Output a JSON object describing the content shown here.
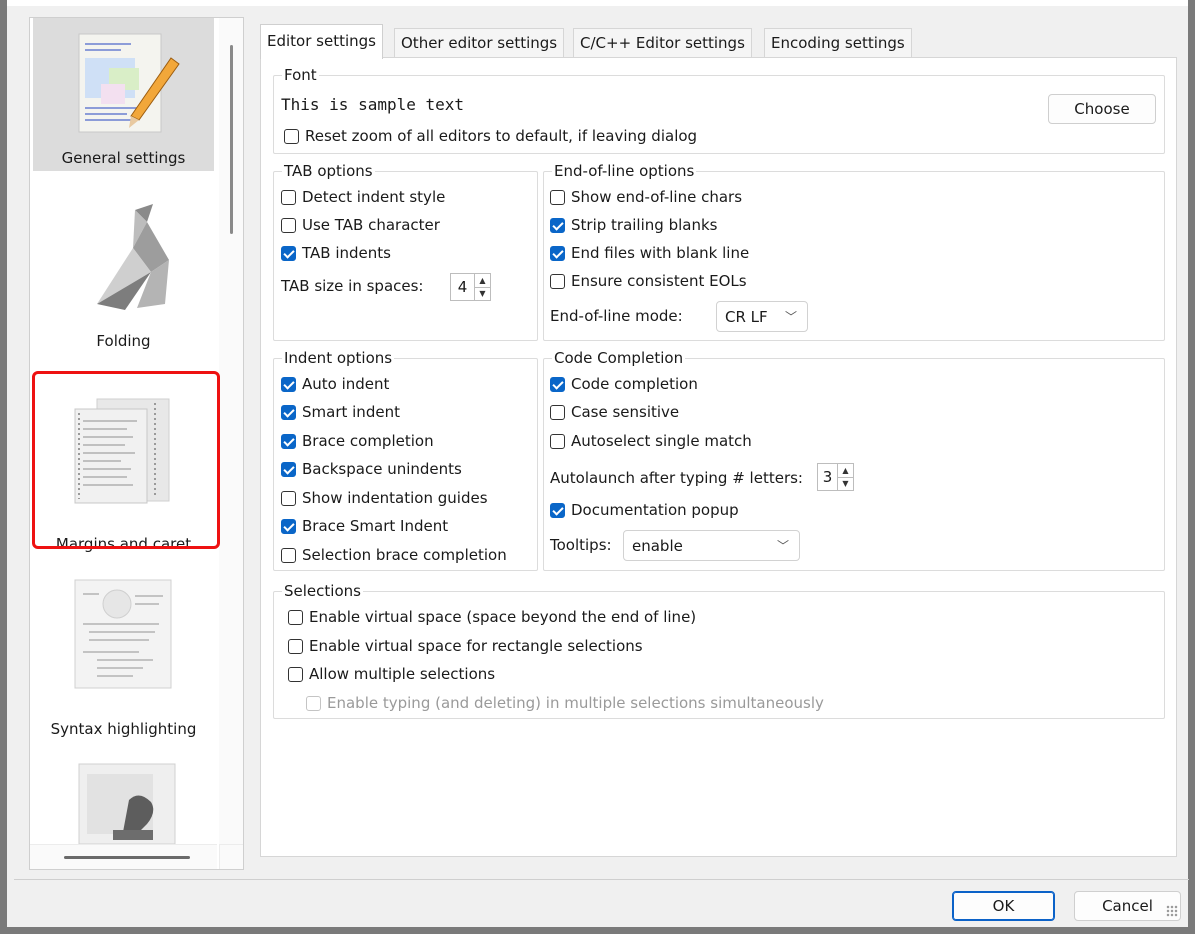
{
  "sidebar": {
    "items": [
      {
        "label": "General settings",
        "selected": true
      },
      {
        "label": "Folding"
      },
      {
        "label": "Margins and caret",
        "highlighted": true
      },
      {
        "label": "Syntax highlighting"
      },
      {
        "label": ""
      }
    ]
  },
  "tabs": [
    {
      "label": "Editor settings",
      "active": true
    },
    {
      "label": "Other editor settings"
    },
    {
      "label": "C/C++ Editor settings"
    },
    {
      "label": "Encoding settings"
    }
  ],
  "font": {
    "legend": "Font",
    "sample": "This is sample text",
    "choose_label": "Choose",
    "reset_zoom": {
      "label": "Reset zoom of all editors to default, if leaving dialog",
      "checked": false
    }
  },
  "tab_options": {
    "legend": "TAB options",
    "items": [
      {
        "label": "Detect indent style",
        "checked": false
      },
      {
        "label": "Use TAB character",
        "checked": false
      },
      {
        "label": "TAB indents",
        "checked": true
      }
    ],
    "size_label": "TAB size in spaces:",
    "size_value": "4"
  },
  "eol_options": {
    "legend": "End-of-line options",
    "items": [
      {
        "label": "Show end-of-line chars",
        "checked": false
      },
      {
        "label": "Strip trailing blanks",
        "checked": true
      },
      {
        "label": "End files with blank line",
        "checked": true
      },
      {
        "label": "Ensure consistent EOLs",
        "checked": false
      }
    ],
    "mode_label": "End-of-line mode:",
    "mode_value": "CR LF"
  },
  "indent_options": {
    "legend": "Indent options",
    "items": [
      {
        "label": "Auto indent",
        "checked": true
      },
      {
        "label": "Smart indent",
        "checked": true
      },
      {
        "label": "Brace completion",
        "checked": true
      },
      {
        "label": "Backspace unindents",
        "checked": true
      },
      {
        "label": "Show indentation guides",
        "checked": false
      },
      {
        "label": "Brace Smart Indent",
        "checked": true
      },
      {
        "label": "Selection brace completion",
        "checked": false
      }
    ]
  },
  "code_completion": {
    "legend": "Code Completion",
    "items": [
      {
        "label": "Code completion",
        "checked": true
      },
      {
        "label": "Case sensitive",
        "checked": false
      },
      {
        "label": "Autoselect single match",
        "checked": false
      }
    ],
    "autolaunch_label": "Autolaunch after typing # letters:",
    "autolaunch_value": "3",
    "doc_popup": {
      "label": "Documentation popup",
      "checked": true
    },
    "tooltips_label": "Tooltips:",
    "tooltips_value": "enable"
  },
  "selections": {
    "legend": "Selections",
    "items": [
      {
        "label": "Enable virtual space (space beyond the end of line)",
        "checked": false
      },
      {
        "label": "Enable virtual space for rectangle selections",
        "checked": false
      },
      {
        "label": "Allow multiple selections",
        "checked": false
      },
      {
        "label": "Enable typing (and deleting) in multiple selections simultaneously",
        "checked": false,
        "disabled": true
      }
    ]
  },
  "footer": {
    "ok_label": "OK",
    "cancel_label": "Cancel"
  },
  "colors": {
    "accent": "#0a66c8",
    "highlight_box": "#ee1111"
  }
}
